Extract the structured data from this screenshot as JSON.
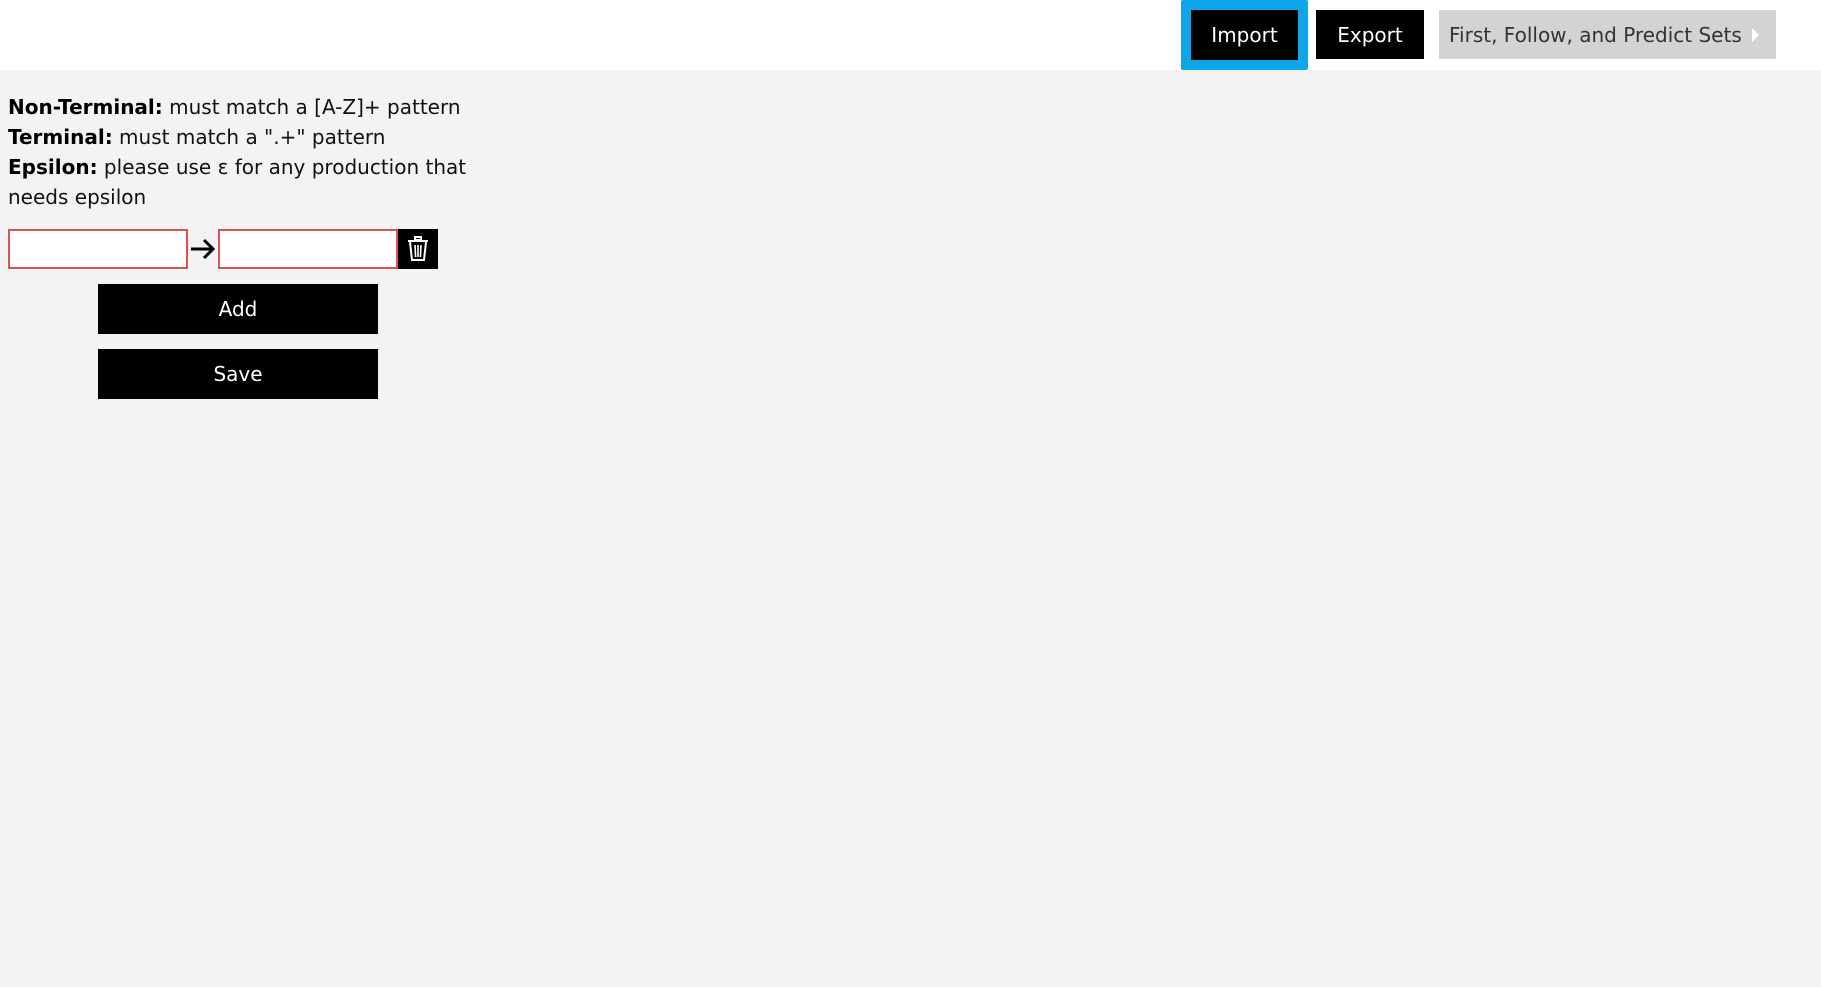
{
  "header": {
    "import_label": "Import",
    "export_label": "Export",
    "sets_label": "First, Follow, and Predict Sets",
    "active_color": "#0ea5e9"
  },
  "rules": [
    {
      "term": "Non-Terminal:",
      "desc": " must match a [A-Z]+ pattern"
    },
    {
      "term": "Terminal:",
      "desc": " must match a \".+\" pattern"
    },
    {
      "term": "Epsilon:",
      "desc": " please use ɛ for any production that needs epsilon"
    }
  ],
  "production": {
    "lhs_value": "",
    "rhs_value": "",
    "arrow_icon": "arrow-right-icon",
    "delete_icon": "trash-icon",
    "error_border_color": "#e05252"
  },
  "actions": {
    "add_label": "Add",
    "save_label": "Save"
  }
}
